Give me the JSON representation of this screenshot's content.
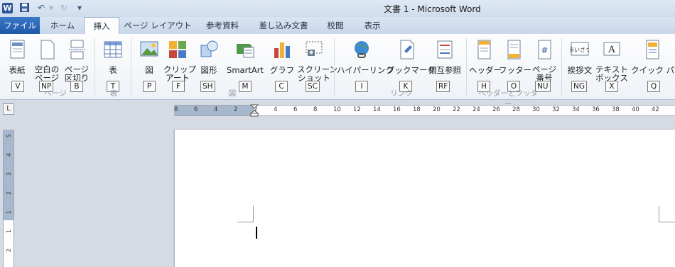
{
  "title_bar": {
    "app_icon": "W",
    "quick_access": [
      {
        "icon": "save-icon",
        "glyph": "💾"
      },
      {
        "icon": "undo-icon",
        "glyph": "↶"
      },
      {
        "icon": "redo-icon",
        "glyph": "↻"
      },
      {
        "icon": "customize-icon",
        "glyph": "▾"
      }
    ],
    "title": "文書 1 - Microsoft Word"
  },
  "tabs": [
    {
      "label": "ファイル"
    },
    {
      "label": "ホーム"
    },
    {
      "label": "挿入"
    },
    {
      "label": "ページ レイアウト"
    },
    {
      "label": "参考資料"
    },
    {
      "label": "差し込み文書"
    },
    {
      "label": "校閲"
    },
    {
      "label": "表示"
    }
  ],
  "ribbon": {
    "buttons": [
      {
        "label": "表紙",
        "keytip": "V",
        "icon": "cover-page-icon"
      },
      {
        "label": "空白の\nページ",
        "keytip": "NP",
        "icon": "blank-page-icon"
      },
      {
        "label": "ページ\n区切り",
        "keytip": "B",
        "icon": "page-break-icon"
      },
      {
        "label": "表",
        "keytip": "T",
        "icon": "table-icon"
      },
      {
        "label": "図",
        "keytip": "P",
        "icon": "picture-icon"
      },
      {
        "label": "クリップ\nアート",
        "keytip": "F",
        "icon": "clipart-icon"
      },
      {
        "label": "図形",
        "keytip": "SH",
        "icon": "shapes-icon"
      },
      {
        "label": "SmartArt",
        "keytip": "M",
        "icon": "smartart-icon"
      },
      {
        "label": "グラフ",
        "keytip": "C",
        "icon": "chart-icon"
      },
      {
        "label": "スクリーン\nショット",
        "keytip": "SC",
        "icon": "screenshot-icon"
      },
      {
        "label": "ハイパーリンク",
        "keytip": "I",
        "icon": "hyperlink-icon"
      },
      {
        "label": "ブックマーク",
        "keytip": "K",
        "icon": "bookmark-icon"
      },
      {
        "label": "相互参照",
        "keytip": "RF",
        "icon": "cross-reference-icon"
      },
      {
        "label": "ヘッダー",
        "keytip": "H",
        "icon": "header-icon"
      },
      {
        "label": "フッター",
        "keytip": "O",
        "icon": "footer-icon"
      },
      {
        "label": "ページ\n番号",
        "keytip": "NU",
        "icon": "page-number-icon"
      },
      {
        "label": "挨拶文",
        "keytip": "NG",
        "icon": "greeting-icon"
      },
      {
        "label": "テキスト\nボックス",
        "keytip": "X",
        "icon": "textbox-icon"
      },
      {
        "label": "クイック パーツ",
        "keytip": "Q",
        "icon": "quick-parts-icon"
      }
    ],
    "groups": [
      {
        "label": "ページ"
      },
      {
        "label": "表"
      },
      {
        "label": "図"
      },
      {
        "label": "リンク"
      },
      {
        "label": "ヘッダーとフッター"
      }
    ]
  },
  "ruler": {
    "corner": "L",
    "h_ticks": [
      "8",
      "6",
      "4",
      "2",
      "2",
      "4",
      "6",
      "8",
      "10",
      "12",
      "14",
      "16",
      "18",
      "20",
      "22",
      "24",
      "26",
      "28",
      "30",
      "32",
      "34",
      "36",
      "38",
      "40",
      "42"
    ],
    "v_ticks": [
      "5",
      "4",
      "3",
      "2",
      "1",
      "1",
      "2"
    ]
  },
  "colors": {
    "file_tab": "#2a62b3",
    "accent": "#2a5699"
  }
}
